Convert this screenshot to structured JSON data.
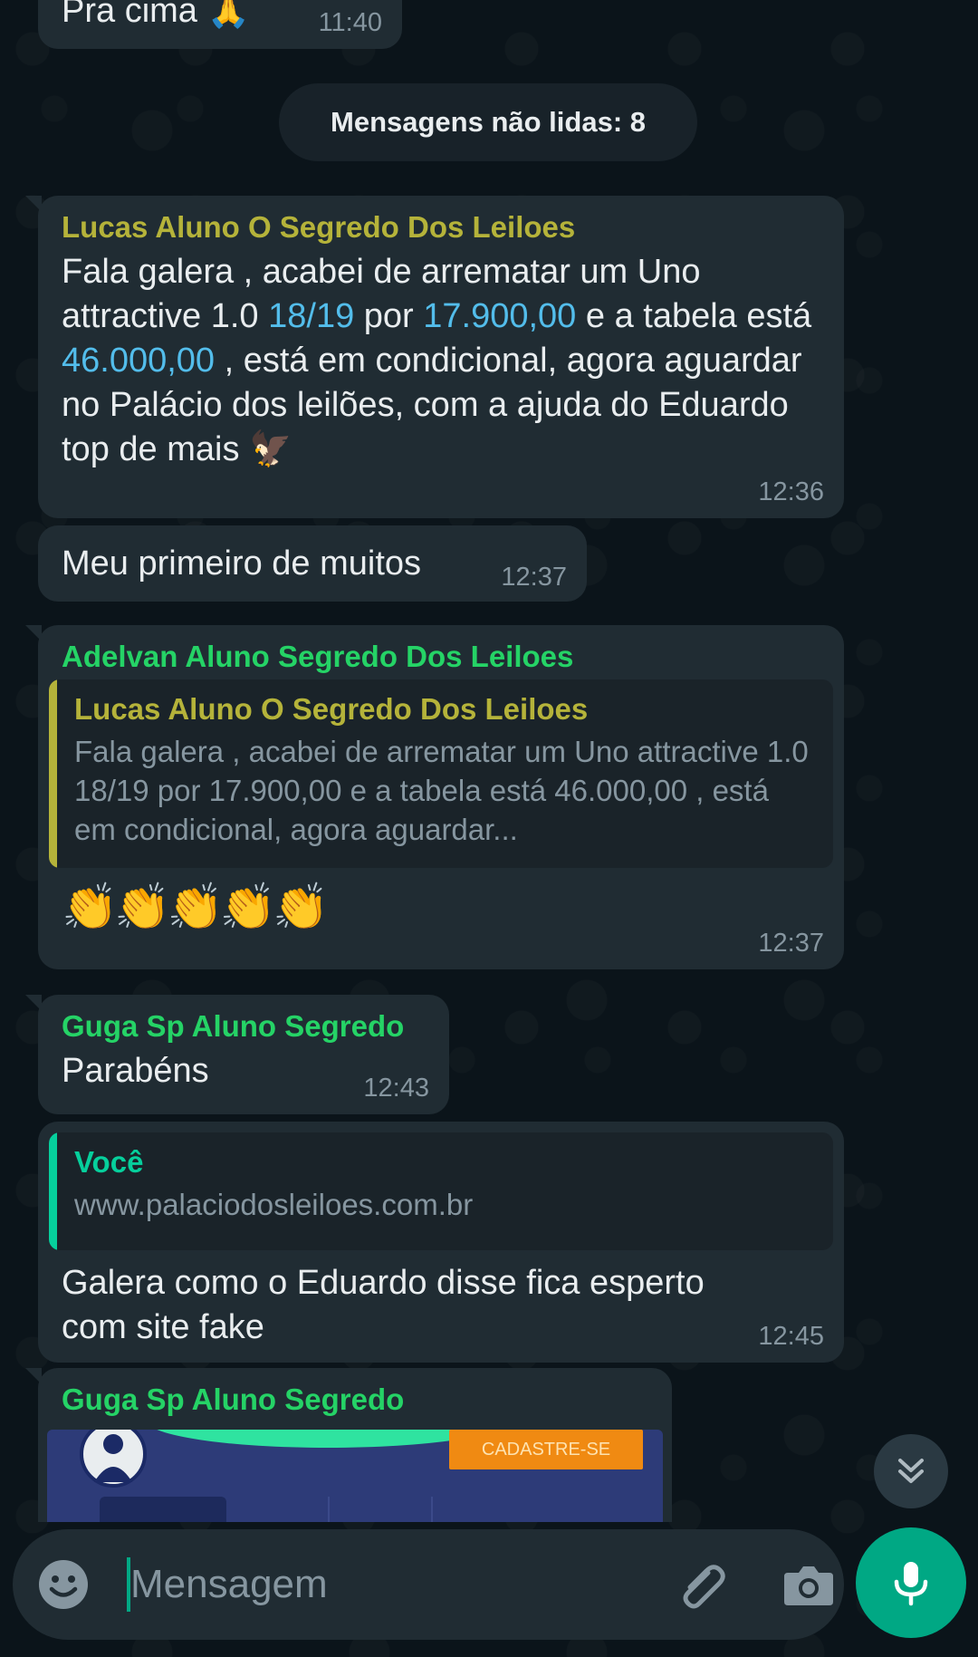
{
  "messages": {
    "prev": {
      "text": "Pra cima 🙏",
      "time": "11:40"
    },
    "unread_label": "Mensagens não lidas: 8",
    "m1": {
      "sender": "Lucas Aluno O Segredo Dos Leiloes",
      "sender_color": "#b5b33a",
      "t_a": "Fala galera , acabei de arrematar um Uno attractive 1.0 ",
      "n1": "18/19",
      "t_b": " por ",
      "n2": "17.900,00",
      "t_c": " e a tabela está ",
      "n3": "46.000,00",
      "t_d": " , está em condicional, agora aguardar no Palácio dos leilões, com a ajuda do Eduardo top de mais 🦅",
      "time": "12:36"
    },
    "m2": {
      "text": "Meu primeiro de muitos",
      "time": "12:37"
    },
    "m3": {
      "sender": "Adelvan Aluno Segredo Dos Leiloes",
      "sender_color": "#25d366",
      "quote_name": "Lucas Aluno O Segredo Dos Leiloes",
      "quote_color": "#b5b33a",
      "quote_text": "Fala galera , acabei de arrematar um Uno attractive 1.0 18/19 por 17.900,00 e a tabela está 46.000,00 , está em condicional, agora aguardar...",
      "body": "👏👏👏👏👏",
      "time": "12:37"
    },
    "m4": {
      "sender": "Guga Sp Aluno Segredo",
      "sender_color": "#25d366",
      "text": "Parabéns",
      "time": "12:43"
    },
    "m5": {
      "quote_name": "Você",
      "quote_color": "#06cf9c",
      "quote_text": "www.palaciodosleiloes.com.br",
      "text": "Galera como o Eduardo disse fica esperto com site fake",
      "time": "12:45"
    },
    "m6": {
      "sender": "Guga Sp Aluno Segredo",
      "sender_color": "#25d366",
      "image_button": "CADASTRE-SE"
    }
  },
  "composer": {
    "placeholder": "Mensagem"
  },
  "icons": {
    "emoji": "emoji-icon",
    "attach": "paperclip-icon",
    "camera": "camera-icon",
    "mic": "microphone-icon",
    "scroll_down": "double-chevron-down-icon"
  },
  "colors": {
    "accent": "#00a884",
    "bubble": "#202c33",
    "background": "#0b141a",
    "link_number": "#53bdeb"
  }
}
